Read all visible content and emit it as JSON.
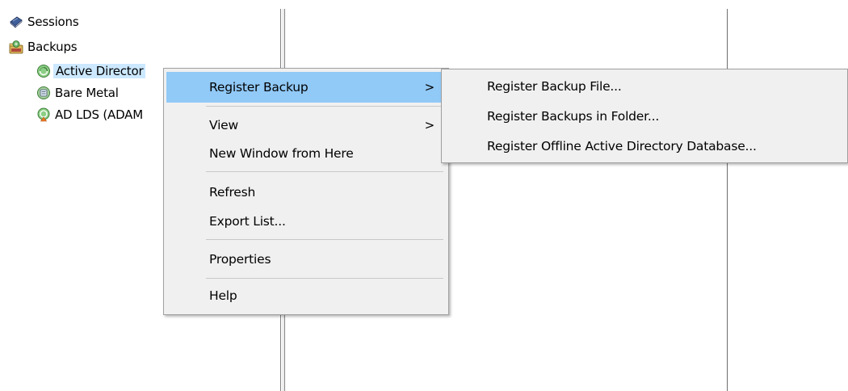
{
  "tree": {
    "items": [
      {
        "label": "Sessions",
        "icon": "sessions-book-icon"
      },
      {
        "label": "Backups",
        "icon": "backups-folder-icon"
      },
      {
        "label": "Active Director",
        "icon": "active-directory-backup-icon",
        "selected": true
      },
      {
        "label": "Bare Metal",
        "icon": "bare-metal-backup-icon"
      },
      {
        "label": "AD LDS (ADAM",
        "icon": "ad-lds-backup-icon"
      }
    ]
  },
  "context_menu": {
    "items": [
      {
        "label": "Register Backup",
        "submenu_arrow": ">",
        "highlighted": true
      },
      {
        "label": "View",
        "submenu_arrow": ">"
      },
      {
        "label": "New Window from Here"
      },
      {
        "label": "Refresh"
      },
      {
        "label": "Export List..."
      },
      {
        "label": "Properties"
      },
      {
        "label": "Help"
      }
    ]
  },
  "submenu": {
    "items": [
      {
        "label": "Register Backup File..."
      },
      {
        "label": "Register Backups in Folder..."
      },
      {
        "label": "Register Offline Active Directory Database..."
      }
    ]
  },
  "colors": {
    "menu_background": "#f0f0f0",
    "menu_highlight": "#91c9f7",
    "selection_background": "#cce8ff",
    "separator": "#c8c8c8"
  }
}
